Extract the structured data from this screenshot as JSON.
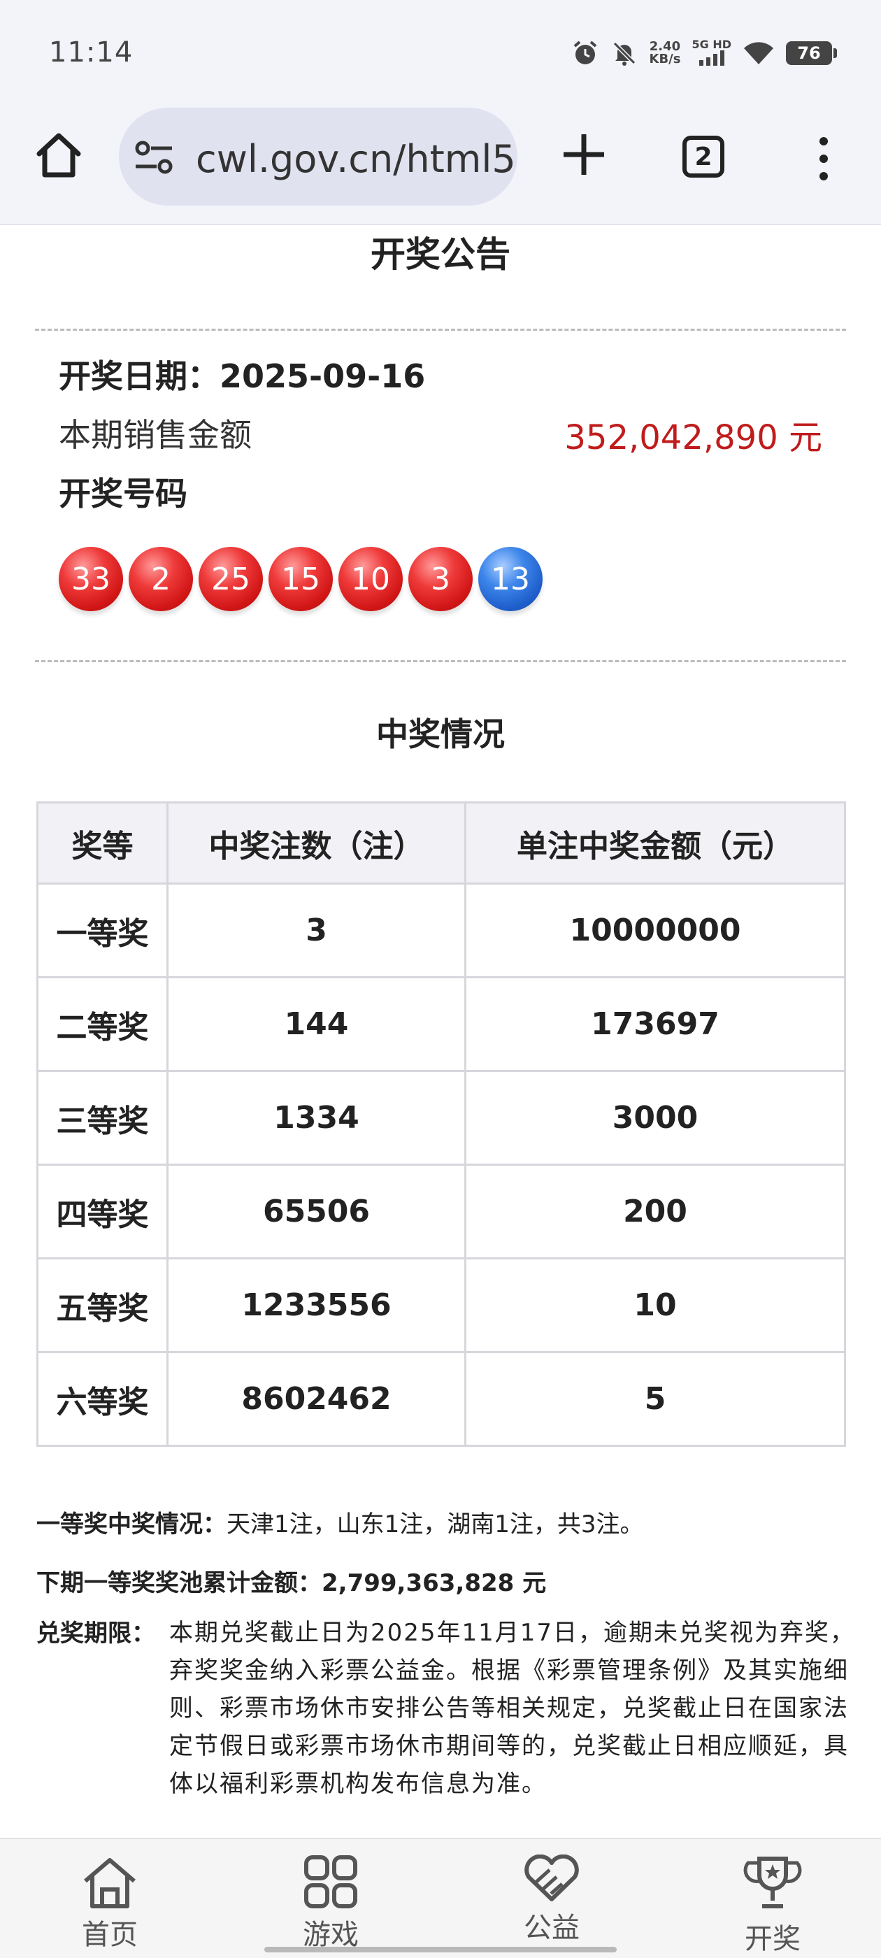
{
  "status_bar": {
    "time": "11:14",
    "net_speed": "2.40",
    "net_speed_unit": "KB/s",
    "network": "5G HD",
    "battery": "76"
  },
  "browser": {
    "url": "cwl.gov.cn/html5/",
    "tab_count": "2"
  },
  "page": {
    "title": "开奖公告",
    "draw_date": "开奖日期：2025-09-16",
    "sales_label": "本期销售金额",
    "sales_value": "352,042,890 元",
    "numbers_label": "开奖号码",
    "red_balls": [
      "33",
      "2",
      "25",
      "15",
      "10",
      "3"
    ],
    "blue_ball": "13",
    "ball_colors": {
      "red": "#d21616",
      "blue": "#1f5fcc"
    },
    "section_title": "中奖情况",
    "table": {
      "headers": [
        "奖等",
        "中奖注数（注）",
        "单注中奖金额（元）"
      ],
      "rows": [
        [
          "一等奖",
          "3",
          "10000000"
        ],
        [
          "二等奖",
          "144",
          "173697"
        ],
        [
          "三等奖",
          "1334",
          "3000"
        ],
        [
          "四等奖",
          "65506",
          "200"
        ],
        [
          "五等奖",
          "1233556",
          "10"
        ],
        [
          "六等奖",
          "8602462",
          "5"
        ]
      ]
    },
    "first_prize_label": "一等奖中奖情况：",
    "first_prize_text": "天津1注，山东1注，湖南1注，共3注。",
    "jackpot_label": "下期一等奖奖池累计金额：",
    "jackpot_value": "2,799,363,828 元",
    "deadline_label": "兑奖期限：",
    "deadline_text": "本期兑奖截止日为2025年11月17日，逾期未兑奖视为弃奖，弃奖奖金纳入彩票公益金。根据《彩票管理条例》及其实施细则、彩票市场休市安排公告等相关规定，兑奖截止日在国家法定节假日或彩票市场休市期间等的，兑奖截止日相应顺延，具体以福利彩票机构发布信息为准。"
  },
  "bottom_nav": {
    "items": [
      {
        "label": "首页",
        "icon": "home-icon"
      },
      {
        "label": "游戏",
        "icon": "grid-icon"
      },
      {
        "label": "公益",
        "icon": "heart-hands-icon"
      },
      {
        "label": "开奖",
        "icon": "trophy-icon"
      }
    ]
  }
}
